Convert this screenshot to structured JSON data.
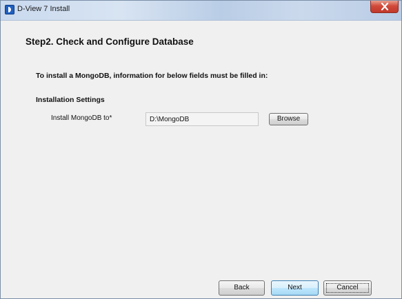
{
  "window": {
    "title": "D-View 7 Install"
  },
  "page": {
    "title": "Step2. Check and Configure Database",
    "intro": "To install a MongoDB, information for below fields must be filled in:",
    "section_heading": "Installation Settings"
  },
  "fields": {
    "install_path": {
      "label": "Install MongoDB to*",
      "value": "D:\\MongoDB"
    }
  },
  "buttons": {
    "browse": "Browse",
    "back": "Back",
    "next": "Next",
    "cancel": "Cancel"
  },
  "icons": {
    "app": "d-link-logo-icon",
    "close": "close-icon"
  },
  "colors": {
    "close_button": "#d2493a",
    "next_button_border": "#3c7fb1",
    "window_background": "#f0f0f0"
  }
}
